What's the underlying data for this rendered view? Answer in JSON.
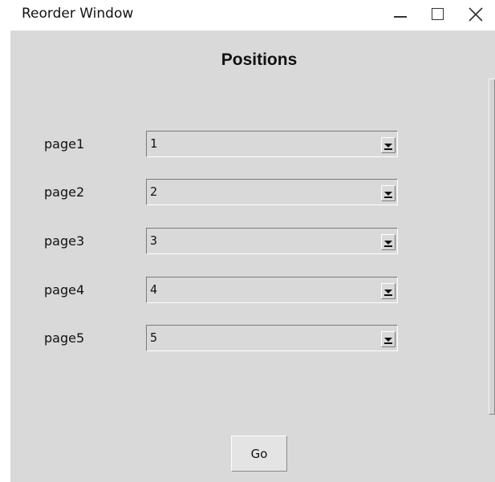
{
  "window": {
    "title": "Reorder Window",
    "controls": {
      "minimize_icon": "minimize-icon",
      "maximize_icon": "maximize-icon",
      "close_icon": "close-icon"
    }
  },
  "form": {
    "heading": "Positions",
    "rows": [
      {
        "label": "page1",
        "value": "1"
      },
      {
        "label": "page2",
        "value": "2"
      },
      {
        "label": "page3",
        "value": "3"
      },
      {
        "label": "page4",
        "value": "4"
      },
      {
        "label": "page5",
        "value": "5"
      }
    ],
    "go_label": "Go"
  },
  "colors": {
    "client_background": "#d9d9d9",
    "titlebar_background": "#ffffff"
  }
}
